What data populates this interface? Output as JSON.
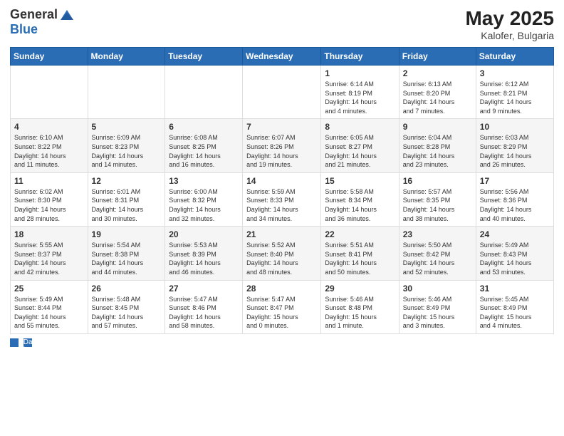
{
  "header": {
    "logo_general": "General",
    "logo_blue": "Blue",
    "title": "May 2025",
    "subtitle": "Kalofer, Bulgaria"
  },
  "days_of_week": [
    "Sunday",
    "Monday",
    "Tuesday",
    "Wednesday",
    "Thursday",
    "Friday",
    "Saturday"
  ],
  "footer": {
    "label": "Daylight hours"
  },
  "weeks": [
    [
      {
        "day": "",
        "info": ""
      },
      {
        "day": "",
        "info": ""
      },
      {
        "day": "",
        "info": ""
      },
      {
        "day": "",
        "info": ""
      },
      {
        "day": "1",
        "info": "Sunrise: 6:14 AM\nSunset: 8:19 PM\nDaylight: 14 hours\nand 4 minutes."
      },
      {
        "day": "2",
        "info": "Sunrise: 6:13 AM\nSunset: 8:20 PM\nDaylight: 14 hours\nand 7 minutes."
      },
      {
        "day": "3",
        "info": "Sunrise: 6:12 AM\nSunset: 8:21 PM\nDaylight: 14 hours\nand 9 minutes."
      }
    ],
    [
      {
        "day": "4",
        "info": "Sunrise: 6:10 AM\nSunset: 8:22 PM\nDaylight: 14 hours\nand 11 minutes."
      },
      {
        "day": "5",
        "info": "Sunrise: 6:09 AM\nSunset: 8:23 PM\nDaylight: 14 hours\nand 14 minutes."
      },
      {
        "day": "6",
        "info": "Sunrise: 6:08 AM\nSunset: 8:25 PM\nDaylight: 14 hours\nand 16 minutes."
      },
      {
        "day": "7",
        "info": "Sunrise: 6:07 AM\nSunset: 8:26 PM\nDaylight: 14 hours\nand 19 minutes."
      },
      {
        "day": "8",
        "info": "Sunrise: 6:05 AM\nSunset: 8:27 PM\nDaylight: 14 hours\nand 21 minutes."
      },
      {
        "day": "9",
        "info": "Sunrise: 6:04 AM\nSunset: 8:28 PM\nDaylight: 14 hours\nand 23 minutes."
      },
      {
        "day": "10",
        "info": "Sunrise: 6:03 AM\nSunset: 8:29 PM\nDaylight: 14 hours\nand 26 minutes."
      }
    ],
    [
      {
        "day": "11",
        "info": "Sunrise: 6:02 AM\nSunset: 8:30 PM\nDaylight: 14 hours\nand 28 minutes."
      },
      {
        "day": "12",
        "info": "Sunrise: 6:01 AM\nSunset: 8:31 PM\nDaylight: 14 hours\nand 30 minutes."
      },
      {
        "day": "13",
        "info": "Sunrise: 6:00 AM\nSunset: 8:32 PM\nDaylight: 14 hours\nand 32 minutes."
      },
      {
        "day": "14",
        "info": "Sunrise: 5:59 AM\nSunset: 8:33 PM\nDaylight: 14 hours\nand 34 minutes."
      },
      {
        "day": "15",
        "info": "Sunrise: 5:58 AM\nSunset: 8:34 PM\nDaylight: 14 hours\nand 36 minutes."
      },
      {
        "day": "16",
        "info": "Sunrise: 5:57 AM\nSunset: 8:35 PM\nDaylight: 14 hours\nand 38 minutes."
      },
      {
        "day": "17",
        "info": "Sunrise: 5:56 AM\nSunset: 8:36 PM\nDaylight: 14 hours\nand 40 minutes."
      }
    ],
    [
      {
        "day": "18",
        "info": "Sunrise: 5:55 AM\nSunset: 8:37 PM\nDaylight: 14 hours\nand 42 minutes."
      },
      {
        "day": "19",
        "info": "Sunrise: 5:54 AM\nSunset: 8:38 PM\nDaylight: 14 hours\nand 44 minutes."
      },
      {
        "day": "20",
        "info": "Sunrise: 5:53 AM\nSunset: 8:39 PM\nDaylight: 14 hours\nand 46 minutes."
      },
      {
        "day": "21",
        "info": "Sunrise: 5:52 AM\nSunset: 8:40 PM\nDaylight: 14 hours\nand 48 minutes."
      },
      {
        "day": "22",
        "info": "Sunrise: 5:51 AM\nSunset: 8:41 PM\nDaylight: 14 hours\nand 50 minutes."
      },
      {
        "day": "23",
        "info": "Sunrise: 5:50 AM\nSunset: 8:42 PM\nDaylight: 14 hours\nand 52 minutes."
      },
      {
        "day": "24",
        "info": "Sunrise: 5:49 AM\nSunset: 8:43 PM\nDaylight: 14 hours\nand 53 minutes."
      }
    ],
    [
      {
        "day": "25",
        "info": "Sunrise: 5:49 AM\nSunset: 8:44 PM\nDaylight: 14 hours\nand 55 minutes."
      },
      {
        "day": "26",
        "info": "Sunrise: 5:48 AM\nSunset: 8:45 PM\nDaylight: 14 hours\nand 57 minutes."
      },
      {
        "day": "27",
        "info": "Sunrise: 5:47 AM\nSunset: 8:46 PM\nDaylight: 14 hours\nand 58 minutes."
      },
      {
        "day": "28",
        "info": "Sunrise: 5:47 AM\nSunset: 8:47 PM\nDaylight: 15 hours\nand 0 minutes."
      },
      {
        "day": "29",
        "info": "Sunrise: 5:46 AM\nSunset: 8:48 PM\nDaylight: 15 hours\nand 1 minute."
      },
      {
        "day": "30",
        "info": "Sunrise: 5:46 AM\nSunset: 8:49 PM\nDaylight: 15 hours\nand 3 minutes."
      },
      {
        "day": "31",
        "info": "Sunrise: 5:45 AM\nSunset: 8:49 PM\nDaylight: 15 hours\nand 4 minutes."
      }
    ]
  ]
}
